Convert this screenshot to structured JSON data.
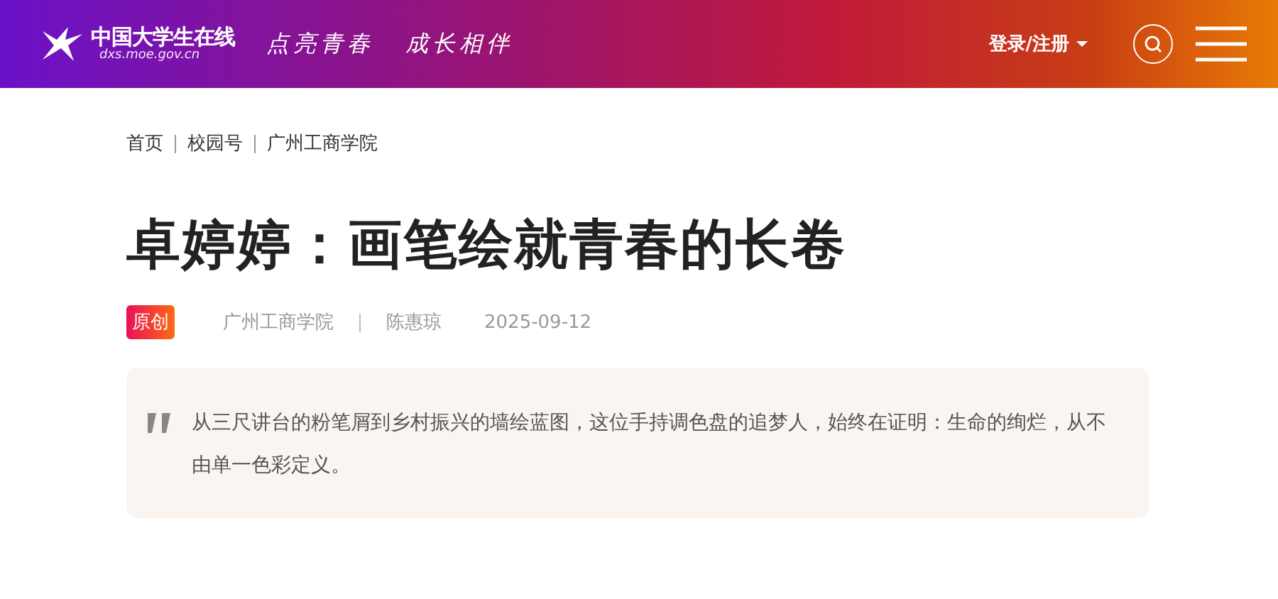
{
  "header": {
    "logo_title": "中国大学生在线",
    "logo_url": "dxs.moe.gov.cn",
    "slogans": [
      "点亮青春",
      "成长相伴"
    ],
    "login": "登录/注册"
  },
  "breadcrumb": [
    "首页",
    "校园号",
    "广州工商学院"
  ],
  "article": {
    "title": "卓婷婷：画笔绘就青春的长卷",
    "badge": "原创",
    "source": "广州工商学院",
    "author": "陈惠琼",
    "date": "2025-09-12",
    "summary": "从三尺讲台的粉笔屑到乡村振兴的墙绘蓝图，这位手持调色盘的追梦人，始终在证明：生命的绚烂，从不由单一色彩定义。"
  }
}
